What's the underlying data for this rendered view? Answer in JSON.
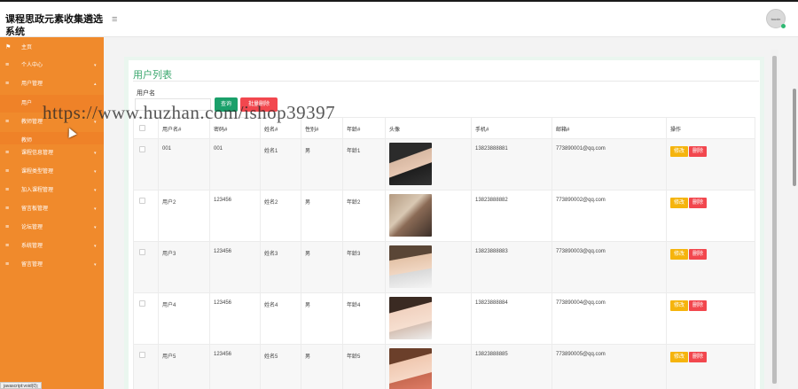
{
  "app": {
    "title": "课程思政元素收集遴选系统",
    "avatar_text": "touxin"
  },
  "sidebar": {
    "items": [
      {
        "icon": "flag-icon",
        "label": "主页",
        "caret": ""
      },
      {
        "icon": "menu-icon",
        "label": "个人中心",
        "caret": "▾"
      },
      {
        "icon": "menu-icon",
        "label": "用户管理",
        "caret": "▴"
      },
      {
        "icon": "",
        "label": "用户",
        "caret": ""
      },
      {
        "icon": "menu-icon",
        "label": "教师管理",
        "caret": "▾"
      },
      {
        "icon": "",
        "label": "教师",
        "caret": ""
      },
      {
        "icon": "menu-icon",
        "label": "课程信息管理",
        "caret": "▾"
      },
      {
        "icon": "menu-icon",
        "label": "课程类型管理",
        "caret": "▾"
      },
      {
        "icon": "menu-icon",
        "label": "加入课程管理",
        "caret": "▾"
      },
      {
        "icon": "menu-icon",
        "label": "留言板管理",
        "caret": "▾"
      },
      {
        "icon": "menu-icon",
        "label": "论坛管理",
        "caret": "▾"
      },
      {
        "icon": "menu-icon",
        "label": "系统管理",
        "caret": "▾"
      },
      {
        "icon": "menu-icon",
        "label": "留言管理",
        "caret": "▾"
      }
    ],
    "status_tip": "javascript:void(0);"
  },
  "main": {
    "title": "用户列表",
    "search": {
      "label": "用户名",
      "value": "",
      "placeholder": ""
    },
    "search_button": "查询",
    "batch_delete_button": "批量删除",
    "columns": [
      "",
      "用户名#",
      "密码#",
      "姓名#",
      "性别#",
      "年龄#",
      "头像",
      "手机#",
      "邮箱#",
      "操作"
    ],
    "rows": [
      {
        "username": "001",
        "password": "001",
        "name": "姓名1",
        "gender": "男",
        "age": "年龄1",
        "phone": "13823888881",
        "email": "773890001@qq.com"
      },
      {
        "username": "用户2",
        "password": "123456",
        "name": "姓名2",
        "gender": "男",
        "age": "年龄2",
        "phone": "13823888882",
        "email": "773890002@qq.com"
      },
      {
        "username": "用户3",
        "password": "123456",
        "name": "姓名3",
        "gender": "男",
        "age": "年龄3",
        "phone": "13823888883",
        "email": "773890003@qq.com"
      },
      {
        "username": "用户4",
        "password": "123456",
        "name": "姓名4",
        "gender": "男",
        "age": "年龄4",
        "phone": "13823888884",
        "email": "773890004@qq.com"
      },
      {
        "username": "用户5",
        "password": "123456",
        "name": "姓名5",
        "gender": "男",
        "age": "年龄5",
        "phone": "13823888885",
        "email": "773890005@qq.com"
      }
    ],
    "edit_label": "修改",
    "delete_label": "删除"
  },
  "watermark": "https://www.huzhan.com/ishop39397",
  "colors": {
    "sidebar": "#f08a2c",
    "accent_green": "#3aa76d",
    "search_button": "#1aa06a",
    "danger": "#f2474e",
    "edit": "#f5b40d"
  }
}
